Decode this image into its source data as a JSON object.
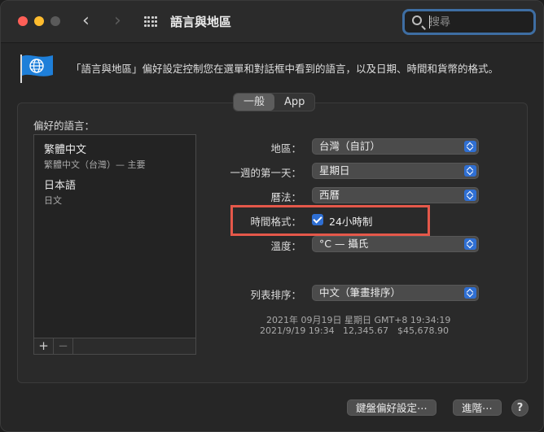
{
  "window": {
    "title": "語言與地區"
  },
  "search": {
    "placeholder": "搜尋",
    "value": ""
  },
  "description": "「語言與地區」偏好設定控制您在選單和對話框中看到的語言，以及日期、時間和貨幣的格式。",
  "tabs": [
    {
      "label": "一般",
      "selected": true
    },
    {
      "label": "App",
      "selected": false
    }
  ],
  "preferred_languages": {
    "label": "偏好的語言：",
    "items": [
      {
        "name": "繁體中文",
        "subtitle": "繁體中文（台灣）— 主要"
      },
      {
        "name": "日本語",
        "subtitle": "日文"
      }
    ],
    "add_label": "+",
    "remove_label": "−"
  },
  "settings": {
    "region": {
      "label": "地區：",
      "value": "台灣（自訂）"
    },
    "first_day": {
      "label": "一週的第一天：",
      "value": "星期日"
    },
    "calendar": {
      "label": "曆法：",
      "value": "西曆"
    },
    "time_format": {
      "label": "時間格式：",
      "checkbox_label": "24小時制",
      "checked": true
    },
    "temperature": {
      "label": "溫度：",
      "value": "°C — 攝氏"
    },
    "list_sort": {
      "label": "列表排序：",
      "value": "中文（筆畫排序）"
    }
  },
  "sample": {
    "line1": "2021年 09月19日 星期日 GMT+8 19:34:19",
    "line2_date": "2021/9/19 19:34",
    "line2_number": "12,345.67",
    "line2_currency": "$45,678.90"
  },
  "buttons": {
    "keyboard": "鍵盤偏好設定⋯",
    "advanced": "進階⋯",
    "help": "?"
  },
  "icons": {
    "back": "chevron-left-icon",
    "forward": "chevron-right-icon",
    "grid": "grid-icon",
    "search": "search-icon",
    "flag": "globe-flag-icon"
  },
  "colors": {
    "accent": "#2f6fd3",
    "highlight": "#e5584a",
    "search_ring": "#3e6ea3"
  }
}
